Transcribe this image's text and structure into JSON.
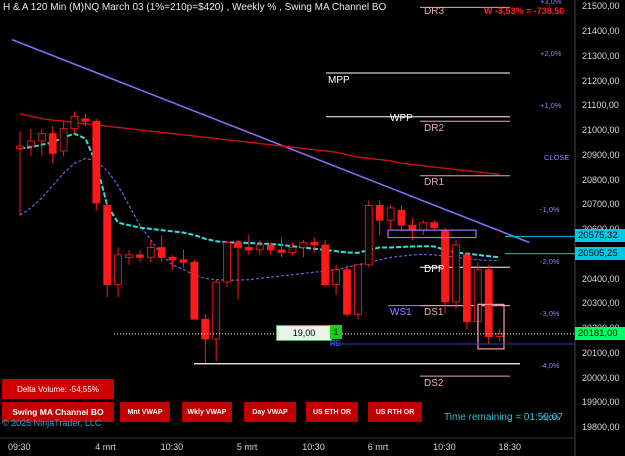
{
  "header": {
    "title": "H & A 120 Min  (M)NQ March 03 (1%=210p=$420) , Weekly % , Swing MA Channel BO",
    "pnl": "W -3,53% = -738,50"
  },
  "price_axis": {
    "ticks": [
      "21500,00",
      "21400,00",
      "21300,00",
      "21200,00",
      "21100,00",
      "21000,00",
      "20900,00",
      "20800,00",
      "20700,00",
      "20600,00",
      "20500,00",
      "20400,00",
      "20300,00",
      "20200,00",
      "20100,00",
      "20000,00",
      "19900,00",
      "19800,00"
    ],
    "tick_values": [
      21500,
      21400,
      21300,
      21200,
      21100,
      21000,
      20900,
      20800,
      20700,
      20600,
      20500,
      20400,
      20300,
      20200,
      20100,
      20000,
      19900,
      19800
    ],
    "current_price": "20181,00",
    "marker_upper": "20575,32",
    "marker_lower": "20505,25",
    "colors": {
      "current": "#00ff66",
      "upper": "#00c8e0",
      "lower": "#00c8e0"
    }
  },
  "pct_labels": [
    {
      "text": "+3,0%",
      "value": 21520
    },
    {
      "text": "+2,0%",
      "value": 21310
    },
    {
      "text": "+1,0%",
      "value": 21100
    },
    {
      "text": "CLOSE",
      "value": 20890
    },
    {
      "text": "-1,0%",
      "value": 20680
    },
    {
      "text": "-2,0%",
      "value": 20470
    },
    {
      "text": "-3,0%",
      "value": 20260
    },
    {
      "text": "-4,0%",
      "value": 20050
    },
    {
      "text": "-5,0%",
      "value": 19840
    }
  ],
  "levels": [
    {
      "name": "DR3",
      "value": 21500,
      "color": "#e8a8b0"
    },
    {
      "name": "MPP",
      "value": 21235,
      "color": "#ffffff"
    },
    {
      "name": "WPP",
      "value": 21058,
      "color": "#ffffff"
    },
    {
      "name": "DR2",
      "value": 21040,
      "color": "#e8a8b0"
    },
    {
      "name": "DR1",
      "value": 20820,
      "color": "#e8a8b0"
    },
    {
      "name": "DPP",
      "value": 20450,
      "color": "#ffffff"
    },
    {
      "name": "WS1",
      "value": 20295,
      "color": "#a080ff"
    },
    {
      "name": "DS1",
      "value": 20295,
      "color": "#e8a8b0"
    },
    {
      "name": "DS2",
      "value": 20010,
      "color": "#e8a8b0"
    }
  ],
  "time_axis": {
    "labels": [
      {
        "text": "09:30",
        "bar": 0
      },
      {
        "text": "4 mrt",
        "bar": 8
      },
      {
        "text": "10:30",
        "bar": 14
      },
      {
        "text": "5 mrt",
        "bar": 21
      },
      {
        "text": "10:30",
        "bar": 27
      },
      {
        "text": "6 mrt",
        "bar": 33
      },
      {
        "text": "10:30",
        "bar": 39
      },
      {
        "text": "18:30",
        "bar": 45
      }
    ]
  },
  "chart_data": {
    "type": "candlestick",
    "candles": [
      {
        "o": 20930,
        "h": 21000,
        "l": 20660,
        "c": 20940
      },
      {
        "o": 20940,
        "h": 21010,
        "l": 20900,
        "c": 20960
      },
      {
        "o": 20960,
        "h": 21010,
        "l": 20900,
        "c": 20990
      },
      {
        "o": 20990,
        "h": 21020,
        "l": 20870,
        "c": 20910
      },
      {
        "o": 20920,
        "h": 21040,
        "l": 20900,
        "c": 21010
      },
      {
        "o": 21010,
        "h": 21080,
        "l": 20990,
        "c": 21060
      },
      {
        "o": 21050,
        "h": 21070,
        "l": 21020,
        "c": 21040
      },
      {
        "o": 21040,
        "h": 21050,
        "l": 20680,
        "c": 20710
      },
      {
        "o": 20700,
        "h": 20720,
        "l": 20330,
        "c": 20380
      },
      {
        "o": 20380,
        "h": 20530,
        "l": 20330,
        "c": 20500
      },
      {
        "o": 20490,
        "h": 20520,
        "l": 20460,
        "c": 20500
      },
      {
        "o": 20500,
        "h": 20520,
        "l": 20470,
        "c": 20490
      },
      {
        "o": 20490,
        "h": 20560,
        "l": 20470,
        "c": 20530
      },
      {
        "o": 20530,
        "h": 20580,
        "l": 20470,
        "c": 20490
      },
      {
        "o": 20490,
        "h": 20500,
        "l": 20440,
        "c": 20480
      },
      {
        "o": 20480,
        "h": 20520,
        "l": 20450,
        "c": 20470
      },
      {
        "o": 20470,
        "h": 20480,
        "l": 20280,
        "c": 20240
      },
      {
        "o": 20240,
        "h": 20260,
        "l": 20060,
        "c": 20160
      },
      {
        "o": 20160,
        "h": 20400,
        "l": 20070,
        "c": 20390
      },
      {
        "o": 20390,
        "h": 20550,
        "l": 20370,
        "c": 20550
      },
      {
        "o": 20550,
        "h": 20560,
        "l": 20320,
        "c": 20530
      },
      {
        "o": 20530,
        "h": 20580,
        "l": 20500,
        "c": 20520
      },
      {
        "o": 20520,
        "h": 20560,
        "l": 20500,
        "c": 20540
      },
      {
        "o": 20540,
        "h": 20550,
        "l": 20500,
        "c": 20520
      },
      {
        "o": 20520,
        "h": 20570,
        "l": 20490,
        "c": 20510
      },
      {
        "o": 20510,
        "h": 20550,
        "l": 20500,
        "c": 20530
      },
      {
        "o": 20530,
        "h": 20560,
        "l": 20490,
        "c": 20550
      },
      {
        "o": 20550,
        "h": 20570,
        "l": 20510,
        "c": 20540
      },
      {
        "o": 20540,
        "h": 20560,
        "l": 20370,
        "c": 20380
      },
      {
        "o": 20380,
        "h": 20460,
        "l": 20340,
        "c": 20440
      },
      {
        "o": 20440,
        "h": 20460,
        "l": 20250,
        "c": 20260
      },
      {
        "o": 20260,
        "h": 20460,
        "l": 20240,
        "c": 20460
      },
      {
        "o": 20460,
        "h": 20720,
        "l": 20450,
        "c": 20700
      },
      {
        "o": 20700,
        "h": 20720,
        "l": 20580,
        "c": 20640
      },
      {
        "o": 20640,
        "h": 20700,
        "l": 20600,
        "c": 20690
      },
      {
        "o": 20680,
        "h": 20700,
        "l": 20600,
        "c": 20620
      },
      {
        "o": 20620,
        "h": 20650,
        "l": 20560,
        "c": 20600
      },
      {
        "o": 20600,
        "h": 20640,
        "l": 20580,
        "c": 20630
      },
      {
        "o": 20630,
        "h": 20640,
        "l": 20600,
        "c": 20610
      },
      {
        "o": 20600,
        "h": 20610,
        "l": 20260,
        "c": 20310
      },
      {
        "o": 20310,
        "h": 20560,
        "l": 20280,
        "c": 20540
      },
      {
        "o": 20500,
        "h": 20510,
        "l": 20200,
        "c": 20230
      },
      {
        "o": 20230,
        "h": 20470,
        "l": 20190,
        "c": 20440
      },
      {
        "o": 20440,
        "h": 20460,
        "l": 20140,
        "c": 20170
      },
      {
        "o": 20170,
        "h": 20200,
        "l": 20150,
        "c": 20181
      }
    ],
    "ma_red": [
      21070,
      21060,
      21050,
      21045,
      21040,
      21035,
      21030,
      21025,
      21020,
      21015,
      21010,
      21005,
      21000,
      20995,
      20990,
      20985,
      20980,
      20975,
      20970,
      20965,
      20960,
      20955,
      20950,
      20945,
      20940,
      20935,
      20930,
      20925,
      20920,
      20915,
      20905,
      20895,
      20890,
      20885,
      20880,
      20870,
      20865,
      20860,
      20855,
      20850,
      20845,
      20840,
      20835,
      20830,
      20825
    ],
    "ma_cyan": [
      20930,
      20935,
      20945,
      20955,
      20975,
      20990,
      20970,
      20870,
      20700,
      20630,
      20620,
      20610,
      20605,
      20600,
      20595,
      20590,
      20580,
      20565,
      20555,
      20550,
      20550,
      20548,
      20546,
      20544,
      20540,
      20535,
      20530,
      20525,
      20520,
      20515,
      20510,
      20508,
      20520,
      20530,
      20530,
      20532,
      20534,
      20535,
      20534,
      20520,
      20510,
      20505,
      20500,
      20495,
      20490
    ],
    "ma_purple": [
      20660,
      20690,
      20730,
      20780,
      20830,
      20870,
      20890,
      20880,
      20840,
      20780,
      20700,
      20620,
      20560,
      20500,
      20460,
      20440,
      20420,
      20405,
      20400,
      20398,
      20398,
      20400,
      20405,
      20410,
      20415,
      20420,
      20425,
      20430,
      20435,
      20440,
      20450,
      20460,
      20470,
      20480,
      20490,
      20495,
      20500,
      20502,
      20500,
      20495,
      20490,
      20485,
      20480,
      20478,
      20476
    ],
    "trendline": {
      "start_bar": 0,
      "start_value": 21370,
      "end_bar": 46,
      "end_value": 20550
    },
    "ylim": [
      19760,
      21530
    ],
    "colors": {
      "up": "#0a0a0a",
      "down": "#ff1a1a",
      "wick": "#ff1a1a",
      "ma_red": "#cc1111",
      "ma_cyan": "#30e0e0",
      "ma_purple": "#7060e0",
      "trend": "#8a6cf0"
    }
  },
  "order": {
    "price_label": "19,00",
    "qty": "1",
    "line_label": "RE"
  },
  "footer": {
    "delta_volume": "Delta Volume: -54,55%",
    "swing_button": "Swing MA Channel BO",
    "copyright": "© 2025 NinjaTrader, LLC",
    "buttons": [
      "Mnt VWAP",
      "Wkly VWAP",
      "Day VWAP",
      "US ETH OR",
      "US RTH OR"
    ],
    "time_remaining": "Time remaining = 01:59:07"
  }
}
